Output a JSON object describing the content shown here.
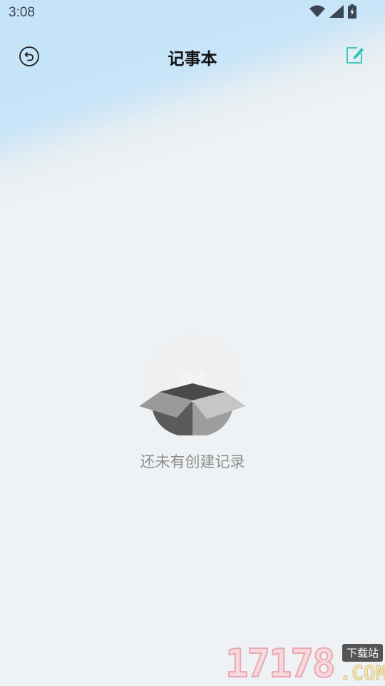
{
  "status_bar": {
    "time": "3:08"
  },
  "header": {
    "title": "记事本",
    "back_icon": "back-circle-icon",
    "edit_icon": "edit-note-icon",
    "accent_color": "#2ec4b6"
  },
  "empty_state": {
    "message": "还未有创建记录",
    "illustration": "empty-box-icon"
  },
  "watermark": {
    "digits": "17178",
    "tag": "下载站",
    "suffix": ".COM"
  }
}
